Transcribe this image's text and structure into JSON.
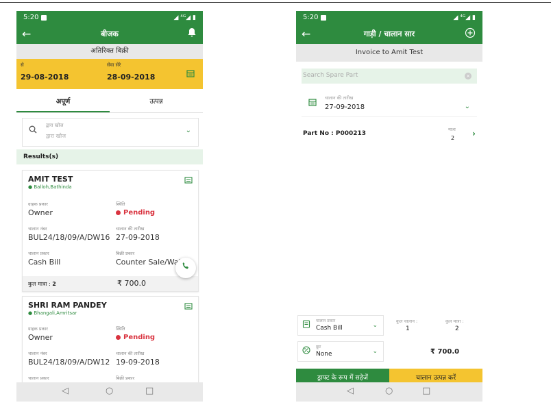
{
  "status": {
    "time": "5:20",
    "signal": "◢ ⁴ᴳ◢ ▮"
  },
  "left_screen": {
    "title": "बीजक",
    "subheader": "अतिरिक्त बिक्री",
    "from_label": "से",
    "from_date": "29-08-2018",
    "to_label": "सेवा सेरे",
    "to_date": "28-09-2018",
    "tabs": [
      "अपूर्ण",
      "उत्पन्न"
    ],
    "search": {
      "label": "द्वारा खोज",
      "placeholder": "द्वारा खोज"
    },
    "results_label": "Results(s)",
    "cards": [
      {
        "name": "AMIT TEST",
        "location": "Balloh,Bathinda",
        "customer_type_label": "ग्राहक प्रकार",
        "customer_type": "Owner",
        "status_label": "स्थिति",
        "status": "Pending",
        "challan_no_label": "चालान नंबर",
        "challan_no": "BUL24/18/09/A/DW16",
        "challan_date_label": "चालान की तारीख",
        "challan_date": "27-09-2018",
        "challan_type_label": "चालान प्रकार",
        "challan_type": "Cash Bill",
        "sale_type_label": "बिक्री प्रकार",
        "sale_type": "Counter Sale/Walk",
        "total_qty_label": "कुल मात्रा :",
        "total_qty": "2",
        "amount": "₹ 700.0"
      },
      {
        "name": "SHRI RAM PANDEY",
        "location": "Bhangali,Amritsar",
        "customer_type_label": "ग्राहक प्रकार",
        "customer_type": "Owner",
        "status_label": "स्थिति",
        "status": "Pending",
        "challan_no_label": "चालान नंबर",
        "challan_no": "BUL24/18/09/A/DW12",
        "challan_date_label": "चालान की तारीख",
        "challan_date": "19-09-2018",
        "challan_type_label": "चालान प्रकार",
        "sale_type_label": "बिक्री प्रकार"
      }
    ]
  },
  "right_screen": {
    "title": "गाड़ी / चालान सार",
    "subheader": "Invoice to Amit Test",
    "search_placeholder": "Search Spare Part",
    "challan_date_label": "चालान की तारीख",
    "challan_date": "27-09-2018",
    "part_no": "Part No : P000213",
    "qty_label": "मात्रा",
    "qty": "2",
    "challan_type_label": "चालान प्रकार",
    "challan_type": "Cash Bill",
    "total_challan_label": "कुल चालान :",
    "total_challan": "1",
    "total_qty_label": "कुल मात्रा :",
    "total_qty": "2",
    "discount_label": "छूट",
    "discount": "None",
    "amount": "₹ 700.0",
    "save_draft_label": "ड्राफ्ट के रूप में सहेजें",
    "generate_label": "चालान उत्पन्न करें"
  }
}
